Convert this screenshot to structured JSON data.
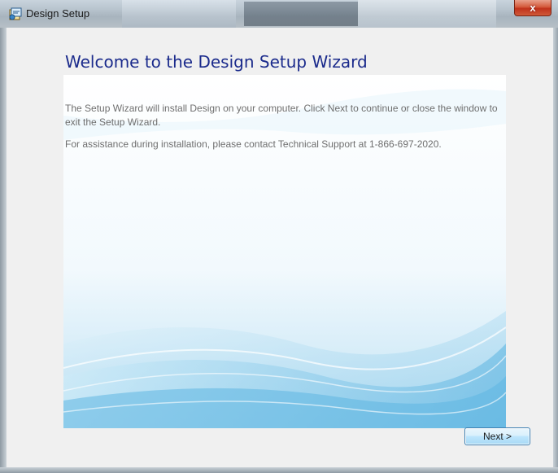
{
  "window": {
    "title": "Design Setup",
    "close_glyph": "x",
    "title_icon": "setup-installer-icon"
  },
  "wizard": {
    "heading": "Welcome to the Design Setup Wizard",
    "paragraph1": "The Setup Wizard will install Design on your computer. Click Next to continue or close the window to exit the Setup Wizard.",
    "paragraph2": "For assistance during installation, please contact Technical Support at 1-866-697-2020."
  },
  "buttons": {
    "next_label": "Next >"
  },
  "colors": {
    "heading": "#1b2b8c",
    "body_text": "#6e6e6e",
    "close_button": "#c0321b",
    "button_border": "#3c7fb1"
  }
}
